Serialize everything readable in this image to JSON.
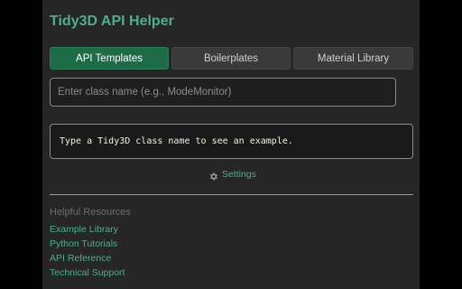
{
  "app": {
    "title": "Tidy3D API Helper"
  },
  "tabs": [
    {
      "label": "API Templates",
      "active": true
    },
    {
      "label": "Boilerplates",
      "active": false
    },
    {
      "label": "Material Library",
      "active": false
    }
  ],
  "search": {
    "value": "",
    "placeholder": "Enter class name (e.g., ModeMonitor)"
  },
  "example": {
    "text": "Type a Tidy3D class name to see an example."
  },
  "settings": {
    "label": "Settings",
    "icon": "gear-icon"
  },
  "resources": {
    "heading": "Helpful Resources",
    "links": [
      "Example Library",
      "Python Tutorials",
      "API Reference",
      "Technical Support"
    ]
  },
  "colors": {
    "accent": "#4caf8e",
    "active_tab": "#1e6b47",
    "panel": "#262626",
    "background": "#000000"
  }
}
